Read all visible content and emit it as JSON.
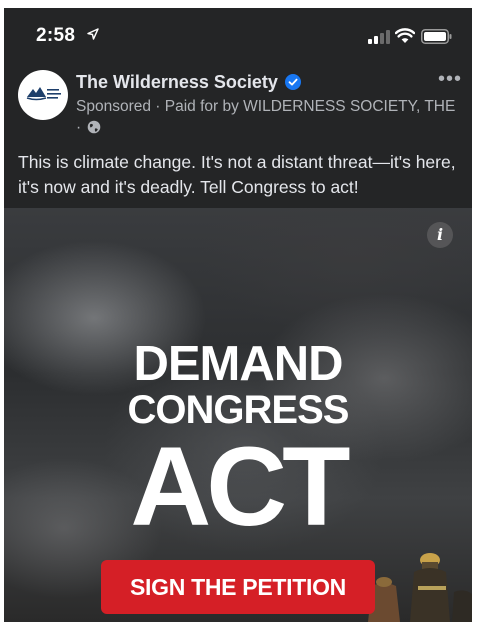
{
  "status_bar": {
    "time": "2:58",
    "location_icon": "location-arrow-icon",
    "signal_icon": "cellular-signal-icon",
    "wifi_icon": "wifi-icon",
    "battery_icon": "battery-icon"
  },
  "post": {
    "avatar_icon": "wilderness-society-logo",
    "page_name": "The Wilderness Society",
    "verified_icon": "verified-badge-icon",
    "sponsored_text": "Sponsored · Paid for by WILDERNESS SOCIETY, THE ·",
    "privacy_icon": "globe-icon",
    "more_icon": "more-options-icon",
    "body_text": "This is climate change. It's not a distant threat—it's here, it's now and it's deadly. Tell Congress to act!"
  },
  "ad": {
    "info_icon": "info-icon",
    "headline_line1": "DEMAND",
    "headline_line2": "CONGRESS",
    "headline_line3": "ACT",
    "cta_label": "SIGN THE PETITION"
  },
  "colors": {
    "background": "#242526",
    "cta": "#d51f26",
    "verified": "#1877f2",
    "text_primary": "#e4e6eb",
    "text_secondary": "#b0b3b8"
  }
}
